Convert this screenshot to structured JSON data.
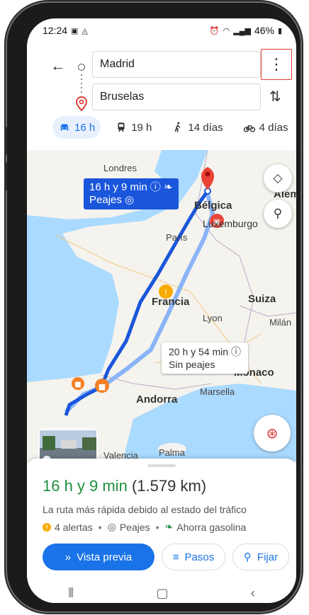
{
  "status_bar": {
    "time": "12:24",
    "battery": "46%"
  },
  "route": {
    "origin": "Madrid",
    "destination": "Bruselas"
  },
  "modes": [
    {
      "name": "car",
      "label": "16 h",
      "active": true
    },
    {
      "name": "transit",
      "label": "19 h",
      "active": false
    },
    {
      "name": "walk",
      "label": "14 días",
      "active": false
    },
    {
      "name": "bike",
      "label": "4 días",
      "active": false
    }
  ],
  "map": {
    "labels": {
      "londres": "Londres",
      "belgica": "Bélgica",
      "alem": "Alem",
      "luxemburgo": "Luxemburgo",
      "paris": "París",
      "francia": "Francia",
      "suiza": "Suiza",
      "lyon": "Lyon",
      "milan": "Milán",
      "monaco": "Mónaco",
      "marsella": "Marsella",
      "andorra": "Andorra",
      "valencia": "Valencia",
      "palma": "Palma"
    },
    "fast_route": {
      "time": "16 h y 9 min",
      "tolls": "Peajes"
    },
    "alt_route": {
      "time": "20 h y 54 min",
      "tolls": "Sin peajes"
    },
    "colors": {
      "fast": "#1a56db",
      "alt": "#8ab4f8",
      "land": "#f5f3ee",
      "water": "#aadaff"
    }
  },
  "sheet": {
    "duration": "16 h y 9 min",
    "distance": "(1.579 km)",
    "reason": "La ruta más rápida debido al estado del tráfico",
    "chips": {
      "alerts": "4 alertas",
      "tolls": "Peajes",
      "fuel": "Ahorra gasolina"
    },
    "buttons": {
      "preview": "Vista previa",
      "steps": "Pasos",
      "pin": "Fijar"
    }
  }
}
